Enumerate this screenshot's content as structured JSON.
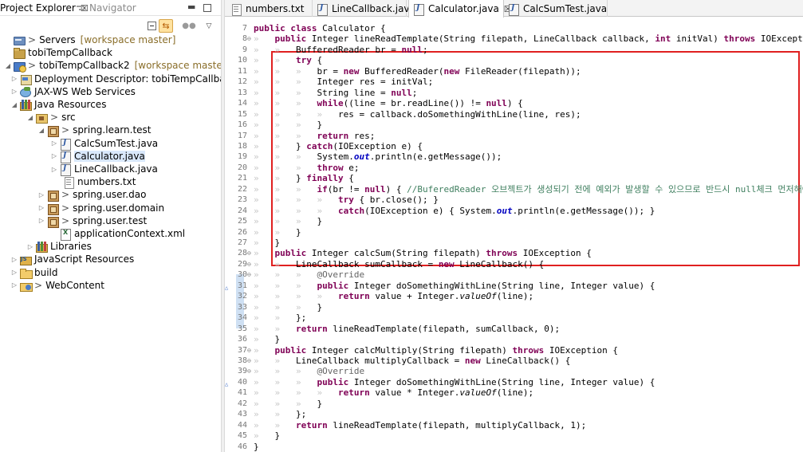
{
  "left_pane": {
    "tabs": [
      {
        "label": "Project Explorer",
        "close": "☒"
      },
      {
        "label": "Navigator"
      }
    ],
    "controls": {
      "minimize": "▬"
    },
    "toolbar": {
      "view_menu": "▽"
    },
    "tree": [
      {
        "label": "Servers",
        "prefix": ">",
        "suffix": "[workspace master]",
        "arrow": "",
        "icon": "server"
      },
      {
        "label": "tobiTempCallback",
        "prefix": "",
        "suffix": "",
        "arrow": "",
        "icon": "project"
      },
      {
        "label": "tobiTempCallback2",
        "prefix": ">",
        "suffix": "[workspace master]",
        "arrow": "◢",
        "icon": "project-web"
      },
      {
        "label": "Deployment Descriptor: tobiTempCallback2",
        "prefix": "",
        "suffix": "",
        "arrow": "▷",
        "icon": "deploy"
      },
      {
        "label": "JAX-WS Web Services",
        "prefix": "",
        "suffix": "",
        "arrow": "▷",
        "icon": "jaxws"
      },
      {
        "label": "Java Resources",
        "prefix": "",
        "suffix": "",
        "arrow": "◢",
        "icon": "lib"
      },
      {
        "label": "src",
        "prefix": ">",
        "suffix": "",
        "arrow": "◢",
        "icon": "srcfolder"
      },
      {
        "label": "spring.learn.test",
        "prefix": ">",
        "suffix": "",
        "arrow": "◢",
        "icon": "package"
      },
      {
        "label": "CalcSumTest.java",
        "prefix": "",
        "suffix": "",
        "arrow": "▷",
        "icon": "java"
      },
      {
        "label": "Calculator.java",
        "prefix": "",
        "suffix": "",
        "arrow": "▷",
        "icon": "java",
        "selected": true
      },
      {
        "label": "LineCallback.java",
        "prefix": "",
        "suffix": "",
        "arrow": "▷",
        "icon": "java"
      },
      {
        "label": "numbers.txt",
        "prefix": "",
        "suffix": "",
        "arrow": "",
        "icon": "txt"
      },
      {
        "label": "spring.user.dao",
        "prefix": ">",
        "suffix": "",
        "arrow": "▷",
        "icon": "package"
      },
      {
        "label": "spring.user.domain",
        "prefix": ">",
        "suffix": "",
        "arrow": "▷",
        "icon": "package"
      },
      {
        "label": "spring.user.test",
        "prefix": ">",
        "suffix": "",
        "arrow": "▷",
        "icon": "package"
      },
      {
        "label": "applicationContext.xml",
        "prefix": "",
        "suffix": "",
        "arrow": "",
        "icon": "xml"
      },
      {
        "label": "Libraries",
        "prefix": "",
        "suffix": "",
        "arrow": "▷",
        "icon": "lib"
      },
      {
        "label": "JavaScript Resources",
        "prefix": "",
        "suffix": "",
        "arrow": "▷",
        "icon": "jsres"
      },
      {
        "label": "build",
        "prefix": "",
        "suffix": "",
        "arrow": "▷",
        "icon": "folder"
      },
      {
        "label": "WebContent",
        "prefix": ">",
        "suffix": "",
        "arrow": "▷",
        "icon": "webcontent"
      }
    ]
  },
  "editor": {
    "tabs": [
      {
        "label": "numbers.txt",
        "icon": "txt"
      },
      {
        "label": "LineCallback.java",
        "icon": "java"
      },
      {
        "label": "Calculator.java",
        "icon": "java",
        "active": true,
        "close": "☒"
      },
      {
        "label": "CalcSumTest.java",
        "icon": "java"
      }
    ],
    "lines": [
      {
        "n": "7",
        "fold": "",
        "mark": "",
        "html": "<span class=\"kw\">public</span> <span class=\"kw\">class</span> Calculator {"
      },
      {
        "n": "8",
        "fold": "⊖",
        "mark": "",
        "html": "<span class=\"ws\">»</span>   <span class=\"kw\">public</span> Integer lineReadTemplate(String filepath, LineCallback callback, <span class=\"kw\">int</span> initVal) <span class=\"kw\">throws</span> IOException {"
      },
      {
        "n": "9",
        "fold": "",
        "mark": "",
        "html": "<span class=\"ws\">»</span>   <span class=\"ws\">»</span>   BufferedReader br = <span class=\"kw\">null</span>;"
      },
      {
        "n": "10",
        "fold": "",
        "mark": "",
        "html": "<span class=\"ws\">»</span>   <span class=\"ws\">»</span>   <span class=\"kw\">try</span> {"
      },
      {
        "n": "11",
        "fold": "",
        "mark": "",
        "html": "<span class=\"ws\">»</span>   <span class=\"ws\">»</span>   <span class=\"ws\">»</span>   br = <span class=\"kw\">new</span> BufferedReader(<span class=\"kw\">new</span> FileReader(filepath));"
      },
      {
        "n": "12",
        "fold": "",
        "mark": "",
        "html": "<span class=\"ws\">»</span>   <span class=\"ws\">»</span>   <span class=\"ws\">»</span>   Integer res = initVal;"
      },
      {
        "n": "13",
        "fold": "",
        "mark": "",
        "html": "<span class=\"ws\">»</span>   <span class=\"ws\">»</span>   <span class=\"ws\">»</span>   String line = <span class=\"kw\">null</span>;"
      },
      {
        "n": "14",
        "fold": "",
        "mark": "",
        "html": "<span class=\"ws\">»</span>   <span class=\"ws\">»</span>   <span class=\"ws\">»</span>   <span class=\"kw\">while</span>((line = br.readLine()) != <span class=\"kw\">null</span>) {"
      },
      {
        "n": "15",
        "fold": "",
        "mark": "",
        "html": "<span class=\"ws\">»</span>   <span class=\"ws\">»</span>   <span class=\"ws\">»</span>   <span class=\"ws\">»</span>   res = callback.doSomethingWithLine(line, res);"
      },
      {
        "n": "16",
        "fold": "",
        "mark": "",
        "html": "<span class=\"ws\">»</span>   <span class=\"ws\">»</span>   <span class=\"ws\">»</span>   }"
      },
      {
        "n": "17",
        "fold": "",
        "mark": "",
        "html": "<span class=\"ws\">»</span>   <span class=\"ws\">»</span>   <span class=\"ws\">»</span>   <span class=\"kw\">return</span> res;"
      },
      {
        "n": "18",
        "fold": "",
        "mark": "",
        "html": "<span class=\"ws\">»</span>   <span class=\"ws\">»</span>   } <span class=\"kw\">catch</span>(IOException e) {"
      },
      {
        "n": "19",
        "fold": "",
        "mark": "",
        "html": "<span class=\"ws\">»</span>   <span class=\"ws\">»</span>   <span class=\"ws\">»</span>   System.<span class=\"fld\">out</span>.println(e.getMessage());"
      },
      {
        "n": "20",
        "fold": "",
        "mark": "",
        "html": "<span class=\"ws\">»</span>   <span class=\"ws\">»</span>   <span class=\"ws\">»</span>   <span class=\"kw\">throw</span> e;"
      },
      {
        "n": "21",
        "fold": "",
        "mark": "",
        "html": "<span class=\"ws\">»</span>   <span class=\"ws\">»</span>   } <span class=\"kw\">finally</span> {"
      },
      {
        "n": "22",
        "fold": "",
        "mark": "",
        "html": "<span class=\"ws\">»</span>   <span class=\"ws\">»</span>   <span class=\"ws\">»</span>   <span class=\"kw\">if</span>(br != <span class=\"kw\">null</span>) { <span class=\"cmt\">//BuferedReader 오브젝트가 생성되기 전에 예외가 발생할 수 있으므로 반드시 null체크 먼저해야함</span>"
      },
      {
        "n": "23",
        "fold": "",
        "mark": "",
        "html": "<span class=\"ws\">»</span>   <span class=\"ws\">»</span>   <span class=\"ws\">»</span>   <span class=\"ws\">»</span>   <span class=\"kw\">try</span> { br.close(); }"
      },
      {
        "n": "24",
        "fold": "",
        "mark": "",
        "html": "<span class=\"ws\">»</span>   <span class=\"ws\">»</span>   <span class=\"ws\">»</span>   <span class=\"ws\">»</span>   <span class=\"kw\">catch</span>(IOException e) { System.<span class=\"fld\">out</span>.println(e.getMessage()); }"
      },
      {
        "n": "25",
        "fold": "",
        "mark": "",
        "html": "<span class=\"ws\">»</span>   <span class=\"ws\">»</span>   <span class=\"ws\">»</span>   }"
      },
      {
        "n": "26",
        "fold": "",
        "mark": "",
        "html": "<span class=\"ws\">»</span>   <span class=\"ws\">»</span>   }"
      },
      {
        "n": "27",
        "fold": "",
        "mark": "",
        "html": "<span class=\"ws\">»</span>   }"
      },
      {
        "n": "28",
        "fold": "⊖",
        "mark": "",
        "html": "<span class=\"ws\">»</span>   <span class=\"kw\">public</span> Integer calcSum(String filepath) <span class=\"kw\">throws</span> IOException {"
      },
      {
        "n": "29",
        "fold": "⊖",
        "mark": "",
        "html": "<span class=\"ws\">»</span>   <span class=\"ws\">»</span>   LineCallback sumCallback = <span class=\"kw\">new</span> LineCallback() {"
      },
      {
        "n": "30",
        "fold": "⊖",
        "mark": "",
        "html": "<span class=\"ws\">»</span>   <span class=\"ws\">»</span>   <span class=\"ws\">»</span>   <span class=\"ann\">@Override</span>"
      },
      {
        "n": "31",
        "fold": "",
        "mark": "△",
        "html": "<span class=\"ws\">»</span>   <span class=\"ws\">»</span>   <span class=\"ws\">»</span>   <span class=\"kw\">public</span> Integer doSomethingWithLine(String line, Integer value) {"
      },
      {
        "n": "32",
        "fold": "",
        "mark": "",
        "html": "<span class=\"ws\">»</span>   <span class=\"ws\">»</span>   <span class=\"ws\">»</span>   <span class=\"ws\">»</span>   <span class=\"kw\">return</span> value + Integer.<span class=\"it\">valueOf</span>(line);"
      },
      {
        "n": "33",
        "fold": "",
        "mark": "",
        "html": "<span class=\"ws\">»</span>   <span class=\"ws\">»</span>   <span class=\"ws\">»</span>   }"
      },
      {
        "n": "34",
        "fold": "",
        "mark": "",
        "html": "<span class=\"ws\">»</span>   <span class=\"ws\">»</span>   };"
      },
      {
        "n": "35",
        "fold": "",
        "mark": "",
        "html": "<span class=\"ws\">»</span>   <span class=\"ws\">»</span>   <span class=\"kw\">return</span> lineReadTemplate(filepath, sumCallback, 0);"
      },
      {
        "n": "36",
        "fold": "",
        "mark": "",
        "html": "<span class=\"ws\">»</span>   }"
      },
      {
        "n": "37",
        "fold": "⊖",
        "mark": "",
        "html": "<span class=\"ws\">»</span>   <span class=\"kw\">public</span> Integer calcMultiply(String filepath) <span class=\"kw\">throws</span> IOException {"
      },
      {
        "n": "38",
        "fold": "⊖",
        "mark": "",
        "html": "<span class=\"ws\">»</span>   <span class=\"ws\">»</span>   LineCallback multiplyCallback = <span class=\"kw\">new</span> LineCallback() {"
      },
      {
        "n": "39",
        "fold": "⊖",
        "mark": "",
        "html": "<span class=\"ws\">»</span>   <span class=\"ws\">»</span>   <span class=\"ws\">»</span>   <span class=\"ann\">@Override</span>"
      },
      {
        "n": "40",
        "fold": "",
        "mark": "△",
        "html": "<span class=\"ws\">»</span>   <span class=\"ws\">»</span>   <span class=\"ws\">»</span>   <span class=\"kw\">public</span> Integer doSomethingWithLine(String line, Integer value) {"
      },
      {
        "n": "41",
        "fold": "",
        "mark": "",
        "html": "<span class=\"ws\">»</span>   <span class=\"ws\">»</span>   <span class=\"ws\">»</span>   <span class=\"ws\">»</span>   <span class=\"kw\">return</span> value * Integer.<span class=\"it\">valueOf</span>(line);"
      },
      {
        "n": "42",
        "fold": "",
        "mark": "",
        "html": "<span class=\"ws\">»</span>   <span class=\"ws\">»</span>   <span class=\"ws\">»</span>   }"
      },
      {
        "n": "43",
        "fold": "",
        "mark": "",
        "html": "<span class=\"ws\">»</span>   <span class=\"ws\">»</span>   };"
      },
      {
        "n": "44",
        "fold": "",
        "mark": "",
        "html": "<span class=\"ws\">»</span>   <span class=\"ws\">»</span>   <span class=\"kw\">return</span> lineReadTemplate(filepath, multiplyCallback, 1);"
      },
      {
        "n": "45",
        "fold": "",
        "mark": "",
        "html": "<span class=\"ws\">»</span>   }"
      },
      {
        "n": "46",
        "fold": "",
        "mark": "",
        "html": "}"
      }
    ]
  },
  "colors": {
    "highlight_box": "#e02020",
    "keyword": "#7f0055",
    "comment": "#3f7f5f",
    "field": "#0000c0",
    "selection": "#d9e8fb"
  }
}
